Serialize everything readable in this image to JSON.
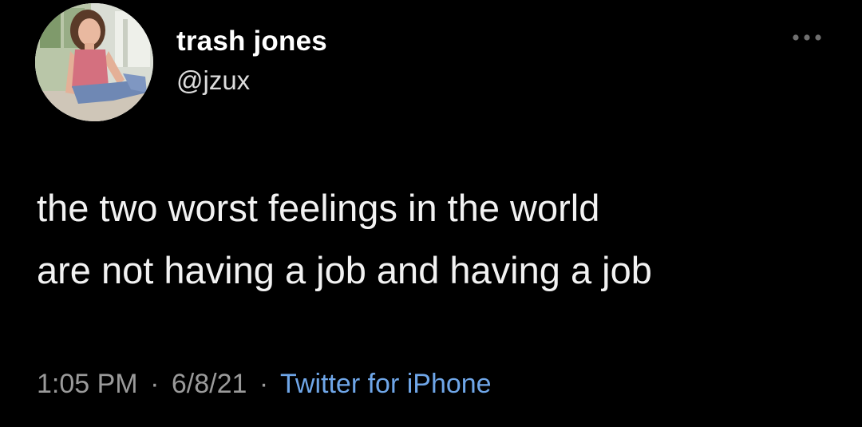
{
  "author": {
    "display_name": "trash jones",
    "handle": "@jzux"
  },
  "tweet": {
    "text": "the two worst feelings in the world\nare not having a job and having a job"
  },
  "meta": {
    "time": "1:05 PM",
    "date": "6/8/21",
    "separator": "·",
    "source": "Twitter for iPhone"
  },
  "icons": {
    "more": "more-options-icon"
  },
  "colors": {
    "background": "#000000",
    "text": "#f2f2f2",
    "secondary": "#9a9a9a",
    "link": "#6fa6e8"
  }
}
